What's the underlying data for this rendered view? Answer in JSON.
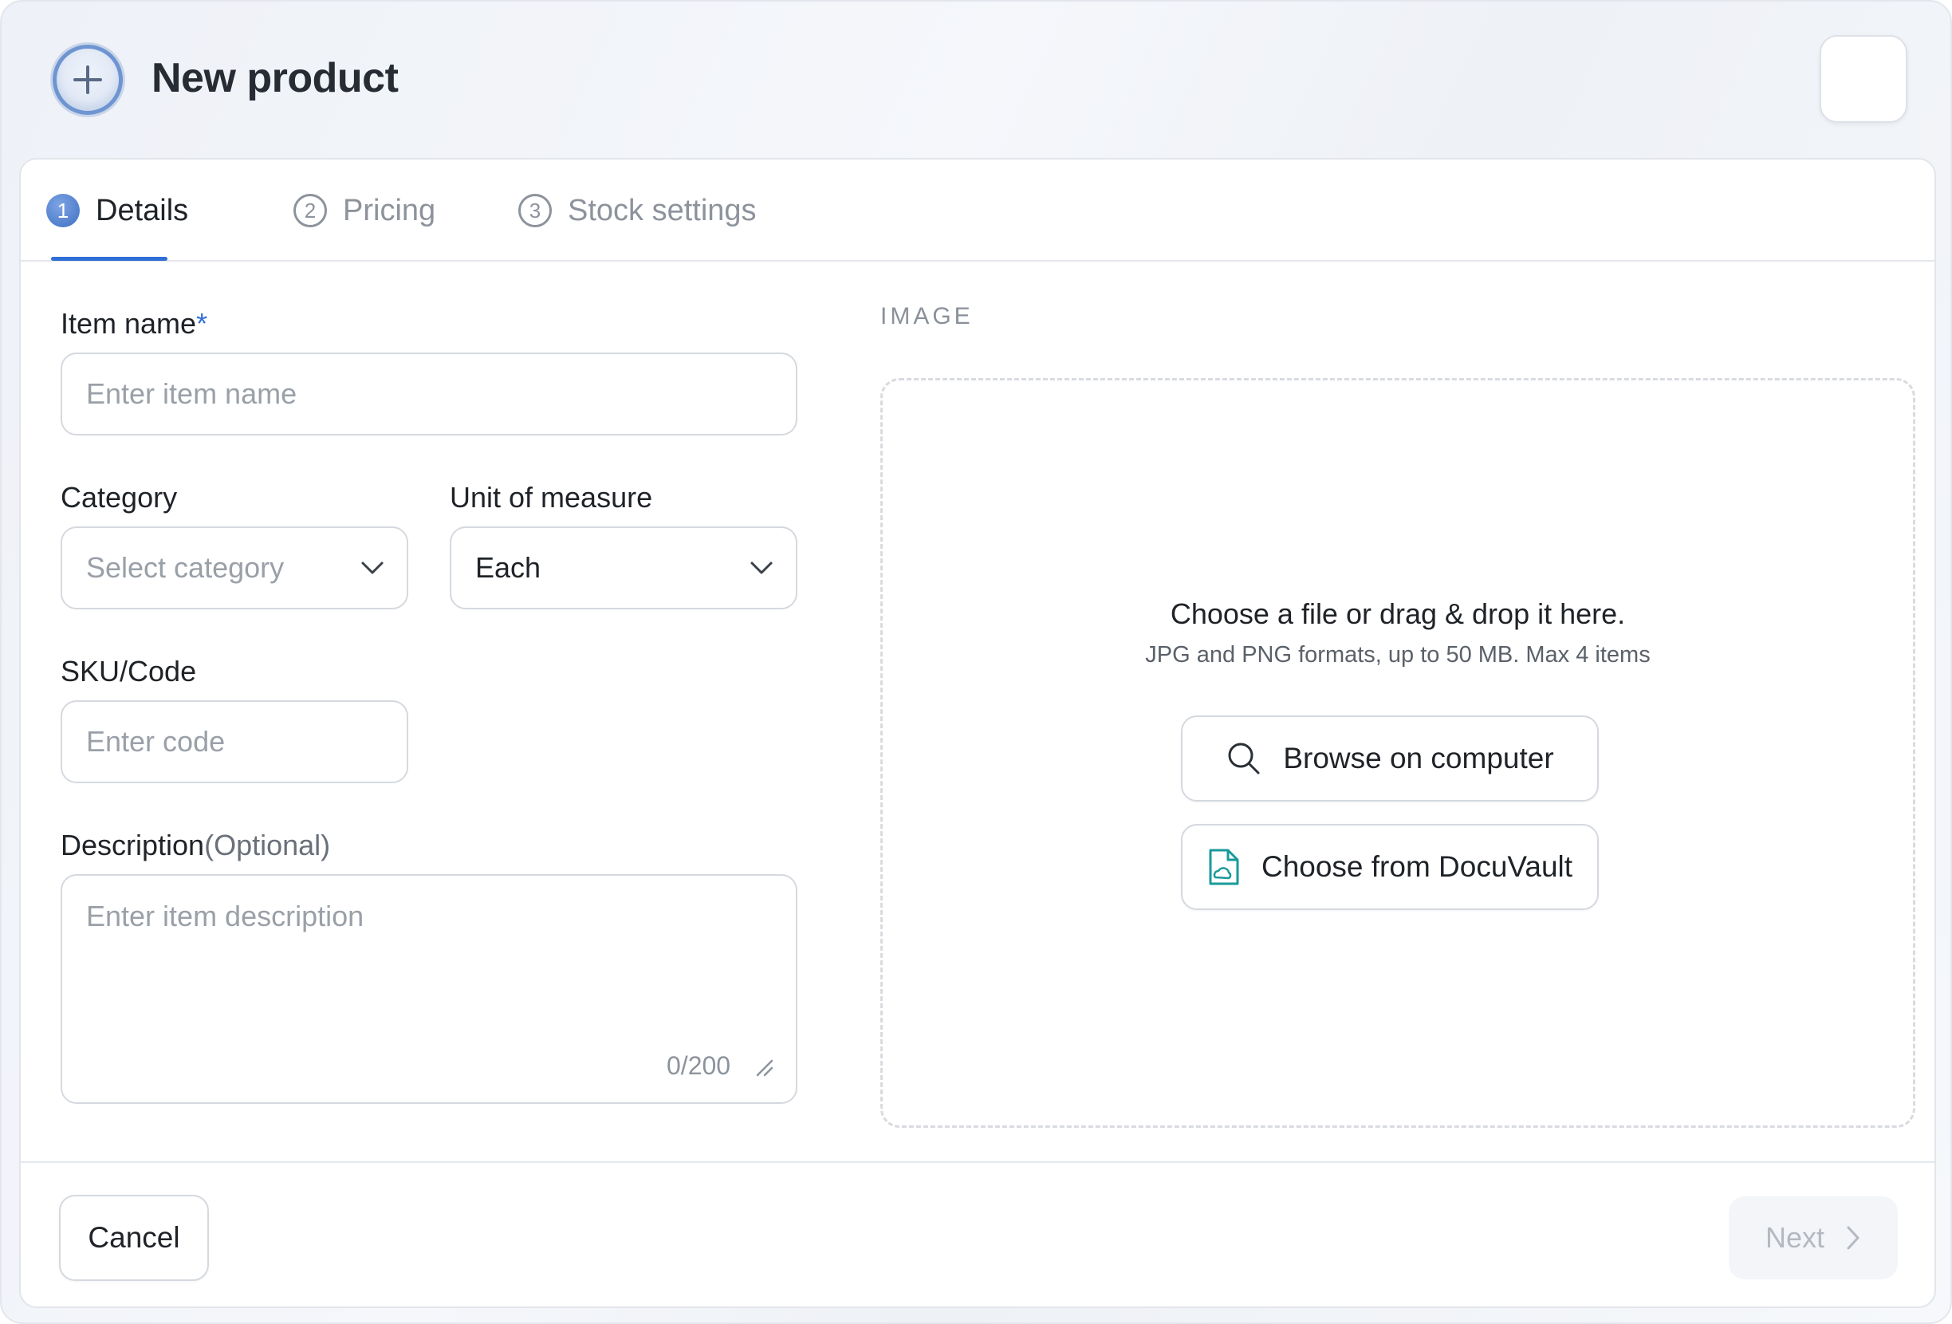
{
  "header": {
    "title": "New product",
    "icon": "plus-circle-icon"
  },
  "tabs": [
    {
      "number": "1",
      "label": "Details",
      "active": true
    },
    {
      "number": "2",
      "label": "Pricing",
      "active": false
    },
    {
      "number": "3",
      "label": "Stock settings",
      "active": false
    }
  ],
  "form": {
    "item_name": {
      "label": "Item name",
      "required_mark": "*",
      "placeholder": "Enter item name",
      "value": ""
    },
    "category": {
      "label": "Category",
      "placeholder": "Select category",
      "value": ""
    },
    "unit": {
      "label": "Unit of measure",
      "value": "Each"
    },
    "sku": {
      "label": "SKU/Code",
      "placeholder": "Enter code",
      "value": ""
    },
    "description": {
      "label": "Description",
      "optional": "(Optional)",
      "placeholder": "Enter item description",
      "value": "",
      "counter": "0/200"
    }
  },
  "image": {
    "section_title": "IMAGE",
    "title": "Choose a file or drag & drop it here.",
    "subtitle": "JPG and PNG formats, up to 50 MB. Max 4 items",
    "browse_label": "Browse on computer",
    "docuvault_label": "Choose from DocuVault"
  },
  "footer": {
    "cancel_label": "Cancel",
    "next_label": "Next"
  },
  "colors": {
    "accent": "#2f6fd6",
    "teal_icon": "#1a9a9a"
  }
}
